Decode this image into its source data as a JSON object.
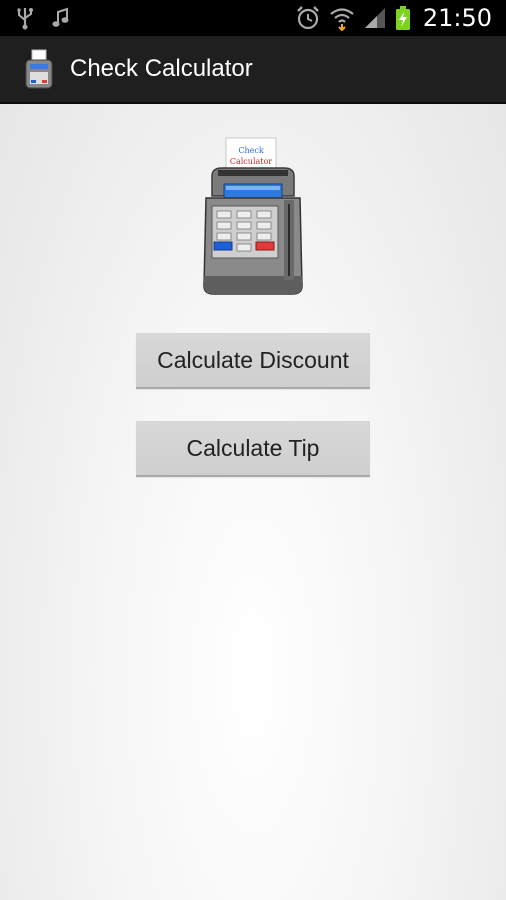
{
  "status_bar": {
    "time": "21:50",
    "icons": [
      "usb-icon",
      "music-note-icon",
      "alarm-icon",
      "wifi-icon",
      "signal-icon",
      "battery-charging-icon"
    ]
  },
  "action_bar": {
    "title": "Check Calculator",
    "icon": "check-terminal-icon"
  },
  "hero": {
    "receipt_line1": "Check",
    "receipt_line2": "Calculator"
  },
  "buttons": {
    "discount": "Calculate Discount",
    "tip": "Calculate Tip"
  },
  "colors": {
    "action_bar": "#1f1f1f",
    "button": "#d3d3d3",
    "battery": "#7ed321"
  }
}
